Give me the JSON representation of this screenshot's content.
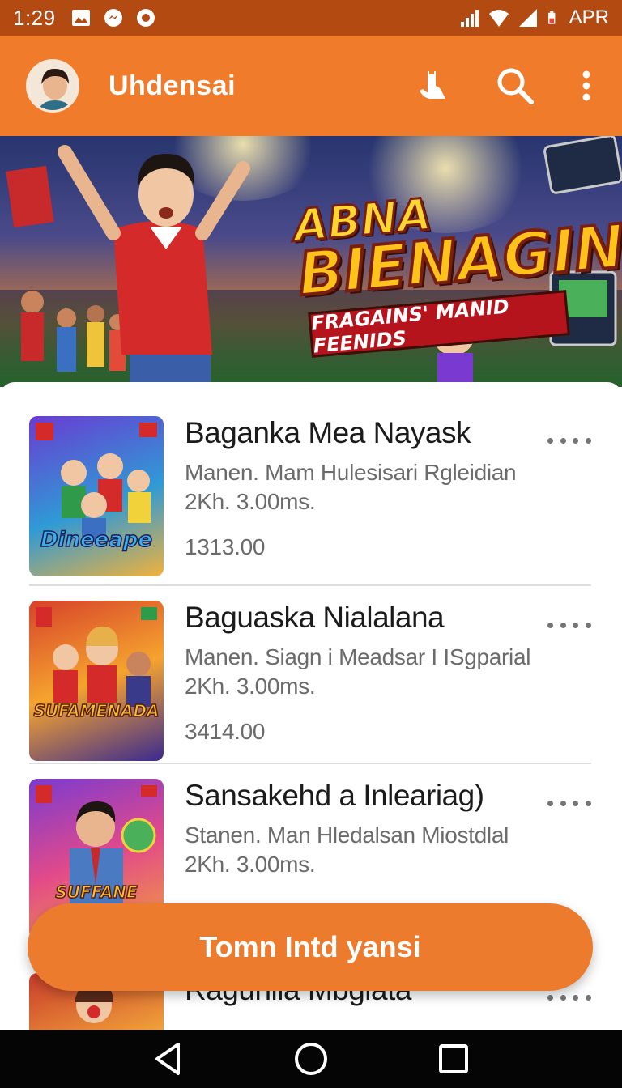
{
  "status_bar": {
    "time": "1:29",
    "carrier": "APR",
    "icons": [
      "photo-icon",
      "messenger-icon",
      "record-icon",
      "signal-icon",
      "wifi-icon",
      "battery-icon"
    ]
  },
  "app_bar": {
    "title": "Uhdensai",
    "actions": [
      "voice-icon",
      "search-icon",
      "more-vert-icon"
    ]
  },
  "banner": {
    "headline_line1": "ABNA",
    "headline_line2": "BIENAGIN",
    "ribbon": "FRAGAINS' MANID FEENIDS"
  },
  "items": [
    {
      "title": "Baganka Mea Nayask",
      "subtitle": "Manen. Mam Hulesisari Rglеidian",
      "meta": "2Kh. 3.00ms.",
      "price": "1313.00",
      "thumb_text": "Dineeape",
      "thumb_colors": [
        "#6a3bd1",
        "#2f9ad6",
        "#f0b23b"
      ]
    },
    {
      "title": "Baguaska Nialalana",
      "subtitle": "Manen. Siagn i Meadsar I ISgparial",
      "meta": "2Kh. 3.00ms.",
      "price": "3414.00",
      "thumb_text": "SUFAMENADA",
      "thumb_colors": [
        "#d7422a",
        "#f5a32f",
        "#3b2a8e"
      ]
    },
    {
      "title": "Sansakehd a Inlеariag)",
      "subtitle": "Stanen. Man Hledalsan Miostdlal",
      "meta": "2Kh. 3.00ms.",
      "price": "",
      "thumb_text": "SUFFANE",
      "thumb_colors": [
        "#7a3ad1",
        "#e24a8a",
        "#f2a23a"
      ]
    },
    {
      "title": "Ragunlia Mbgiata",
      "subtitle": "",
      "meta": "",
      "price": "",
      "thumb_text": "",
      "thumb_colors": [
        "#c93c2a",
        "#f0a03a",
        "#6a3bd1"
      ]
    }
  ],
  "fab": {
    "label": "Tomn Intd yansi"
  },
  "nav_bar": [
    "back-icon",
    "home-icon",
    "recents-icon"
  ],
  "colors": {
    "status_bar": "#b24a12",
    "app_bar": "#f07b2b",
    "fab": "#ec7b2e",
    "nav_bar": "#050505"
  }
}
